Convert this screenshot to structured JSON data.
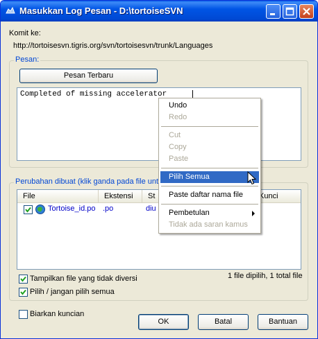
{
  "window": {
    "title": "Masukkan Log Pesan - D:\\tortoiseSVN"
  },
  "commit": {
    "label": "Komit ke:",
    "url": "http://tortoisesvn.tigris.org/svn/tortoisesvn/trunk/Languages"
  },
  "message": {
    "group_label": "Pesan:",
    "recent_button": "Pesan Terbaru",
    "text": "Completed of missing accelerator"
  },
  "changes": {
    "group_label": "Perubahan dibuat (klik ganda pada file untuk perbandingan)",
    "columns": {
      "file": "File",
      "ext": "Ekstensi",
      "status": "St",
      "lock": "Kunci"
    },
    "rows": [
      {
        "file": "Tortoise_id.po",
        "ext": ".po",
        "status": "diu",
        "checked": true
      }
    ],
    "summary": "1 file dipilih, 1 total file",
    "show_unversioned": "Tampilkan file yang tidak diversi",
    "select_all": "Pilih / jangan pilih semua"
  },
  "keep_locks": "Biarkan kuncian",
  "buttons": {
    "ok": "OK",
    "cancel": "Batal",
    "help": "Bantuan"
  },
  "context_menu": {
    "undo": "Undo",
    "redo": "Redo",
    "cut": "Cut",
    "copy": "Copy",
    "paste": "Paste",
    "select_all": "Pilih Semua",
    "paste_filenames": "Paste daftar nama file",
    "spelling": "Pembetulan",
    "no_suggestions": "Tidak ada saran kamus"
  },
  "colors": {
    "accent": "#316ac5",
    "title_bar": "#0055e5",
    "group_label": "#0046d5"
  }
}
